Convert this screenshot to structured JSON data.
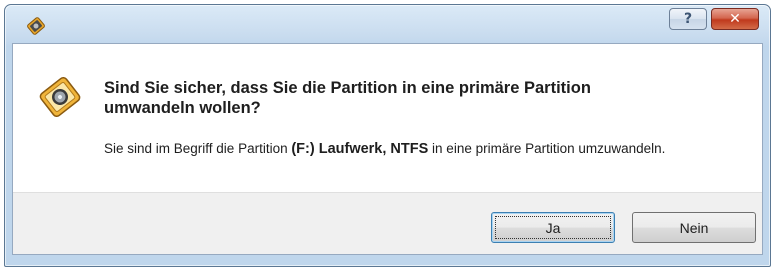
{
  "window": {
    "title_icon": "partition-wizard-icon"
  },
  "titlebar_buttons": {
    "help_label": "?",
    "close_label": "✕"
  },
  "dialog": {
    "icon": "partition-disk-icon",
    "heading": "Sind Sie sicher, dass Sie die Partition in eine primäre Partition umwandeln wollen?",
    "message_pre": "Sie sind im Begriff die Partition ",
    "message_bold": "(F:) Laufwerk, NTFS",
    "message_post": " in eine primäre Partition umzuwandeln."
  },
  "buttons": {
    "yes_label": "Ja",
    "no_label": "Nein"
  },
  "colors": {
    "frame": "#bfd6ec",
    "close_button": "#c0391d",
    "default_button_border": "#3c7fb1"
  }
}
